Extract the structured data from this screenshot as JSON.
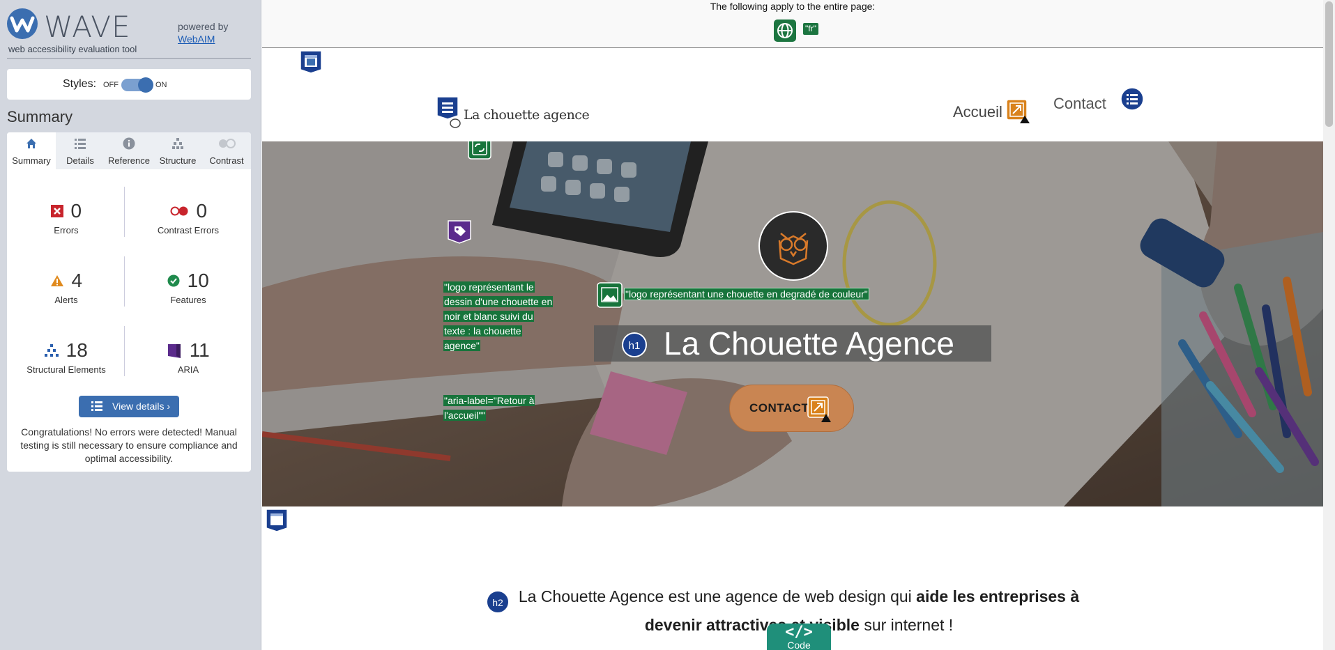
{
  "wave": {
    "name": "WAVE",
    "tagline": "web accessibility evaluation tool",
    "powered_by": "powered by",
    "webaim_link": "WebAIM"
  },
  "styles": {
    "label": "Styles:",
    "off": "OFF",
    "on": "ON",
    "enabled": true
  },
  "summary_title": "Summary",
  "tabs": [
    {
      "label": "Summary",
      "icon": "home-icon",
      "active": true
    },
    {
      "label": "Details",
      "icon": "list-icon",
      "active": false
    },
    {
      "label": "Reference",
      "icon": "info-icon",
      "active": false
    },
    {
      "label": "Structure",
      "icon": "hierarchy-icon",
      "active": false
    },
    {
      "label": "Contrast",
      "icon": "contrast-icon",
      "active": false
    }
  ],
  "stats": {
    "errors": {
      "count": "0",
      "label": "Errors"
    },
    "contrast_errors": {
      "count": "0",
      "label": "Contrast Errors"
    },
    "alerts": {
      "count": "4",
      "label": "Alerts"
    },
    "features": {
      "count": "10",
      "label": "Features"
    },
    "structural": {
      "count": "18",
      "label": "Structural Elements"
    },
    "aria": {
      "count": "11",
      "label": "ARIA"
    }
  },
  "view_details": "View details ›",
  "congrats": "Congratulations! No errors were detected! Manual testing is still necessary to ensure compliance and optimal accessibility.",
  "topbar": {
    "text": "The following apply to the entire page:",
    "lang_badge": "\"fr\""
  },
  "site": {
    "brand": "La chouette agence",
    "nav": {
      "accueil": "Accueil",
      "contact": "Contact"
    },
    "alt_logo": "\"logo représentant le dessin d'une chouette en noir et blanc suivi du texte : la chouette agence\"",
    "aria_label": "\"aria-label=\"Retour à l'accueil\"\"",
    "alt_owl": "\"logo représentant une chouette en degradé de couleur\"",
    "h1": "La Chouette Agence",
    "cta": "CONTACT",
    "h2_part1": "La Chouette Agence est une agence de web design qui ",
    "h2_bold1": "aide les entreprises à devenir attractives et visible",
    "h2_part2": " sur internet !"
  },
  "code_tab": {
    "icon": "</>",
    "label": "Code"
  },
  "colors": {
    "wave_blue": "#3b6eb0",
    "feature_green": "#17743b",
    "alert_orange": "#d9821c",
    "aria_purple": "#5b2b8c",
    "structure_navy": "#1a3f8f"
  }
}
